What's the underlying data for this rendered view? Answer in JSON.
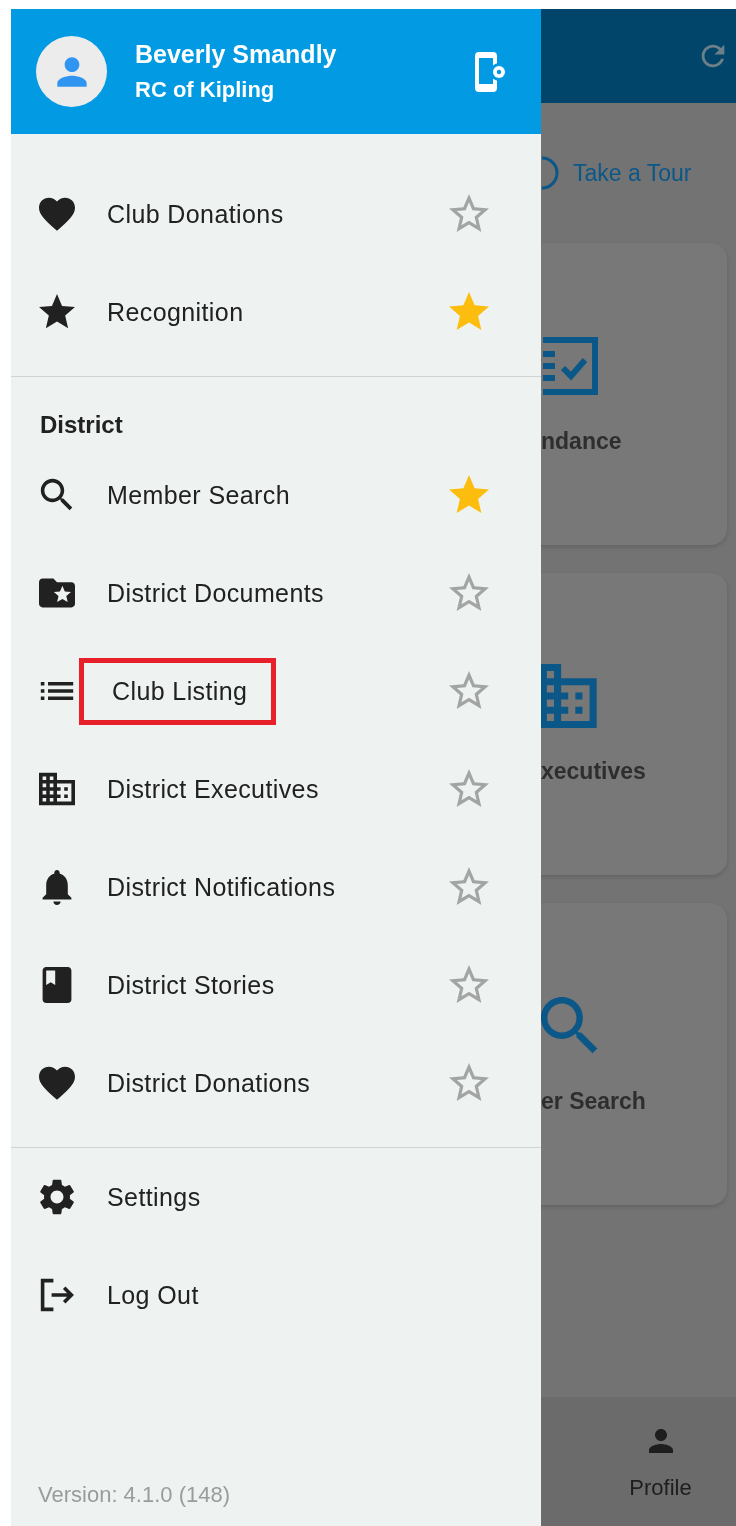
{
  "drawer": {
    "header": {
      "name": "Beverly Smandly",
      "club": "RC of Kipling"
    },
    "sections": [
      {
        "items": [
          {
            "label": "Club Donations",
            "favorite": false
          },
          {
            "label": "Recognition",
            "favorite": true
          }
        ]
      },
      {
        "heading": "District",
        "items": [
          {
            "label": "Member Search",
            "favorite": true,
            "highlighted": false
          },
          {
            "label": "District Documents",
            "favorite": false,
            "highlighted": false
          },
          {
            "label": "Club Listing",
            "favorite": false,
            "highlighted": true
          },
          {
            "label": "District Executives",
            "favorite": false,
            "highlighted": false
          },
          {
            "label": "District Notifications",
            "favorite": false,
            "highlighted": false
          },
          {
            "label": "District Stories",
            "favorite": false,
            "highlighted": false
          },
          {
            "label": "District Donations",
            "favorite": false,
            "highlighted": false
          }
        ]
      },
      {
        "items": [
          {
            "label": "Settings"
          },
          {
            "label": "Log Out"
          }
        ]
      }
    ],
    "version": "Version: 4.1.0 (148)"
  },
  "background": {
    "tour_link": "Take a Tour",
    "cards": [
      {
        "label": "ndance"
      },
      {
        "label": "xecutives"
      },
      {
        "label": "er Search"
      }
    ],
    "bottom_nav": {
      "label": "Profile"
    }
  }
}
